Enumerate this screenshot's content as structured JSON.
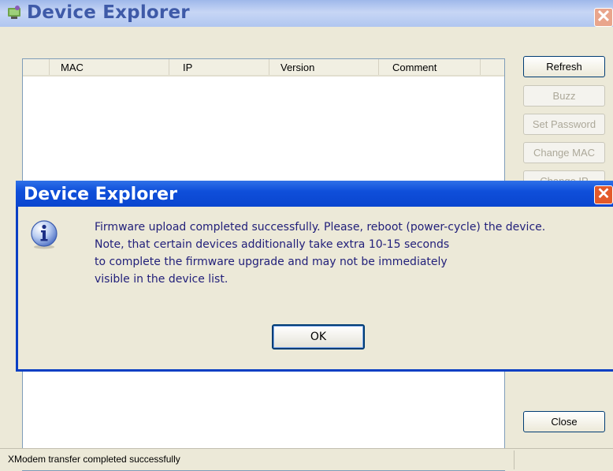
{
  "window": {
    "title": "Device Explorer"
  },
  "list": {
    "columns": [
      "MAC",
      "IP",
      "Version",
      "Comment"
    ]
  },
  "side_buttons": {
    "refresh": "Refresh",
    "buzz": "Buzz",
    "set_password": "Set Password",
    "change_mac": "Change MAC",
    "change_ip": "Change IP",
    "close": "Close"
  },
  "status": {
    "text": "XModem transfer completed successfully"
  },
  "dialog": {
    "title": "Device Explorer",
    "message": "Firmware upload completed successfully. Please, reboot (power-cycle) the device.\nNote, that certain devices additionally take extra 10-15 seconds\nto complete the firmware upgrade and may not be immediately\nvisible in the device list.",
    "ok_label": "OK",
    "close_glyph": "✕"
  },
  "main_close_glyph": "✕",
  "icons": {
    "app": "app-icon",
    "info": "info-icon",
    "close": "close-icon"
  },
  "colors": {
    "dialog_title_bar": "#0f4fda",
    "inactive_title_bar": "#b0c6f0",
    "message_text": "#22207a"
  }
}
